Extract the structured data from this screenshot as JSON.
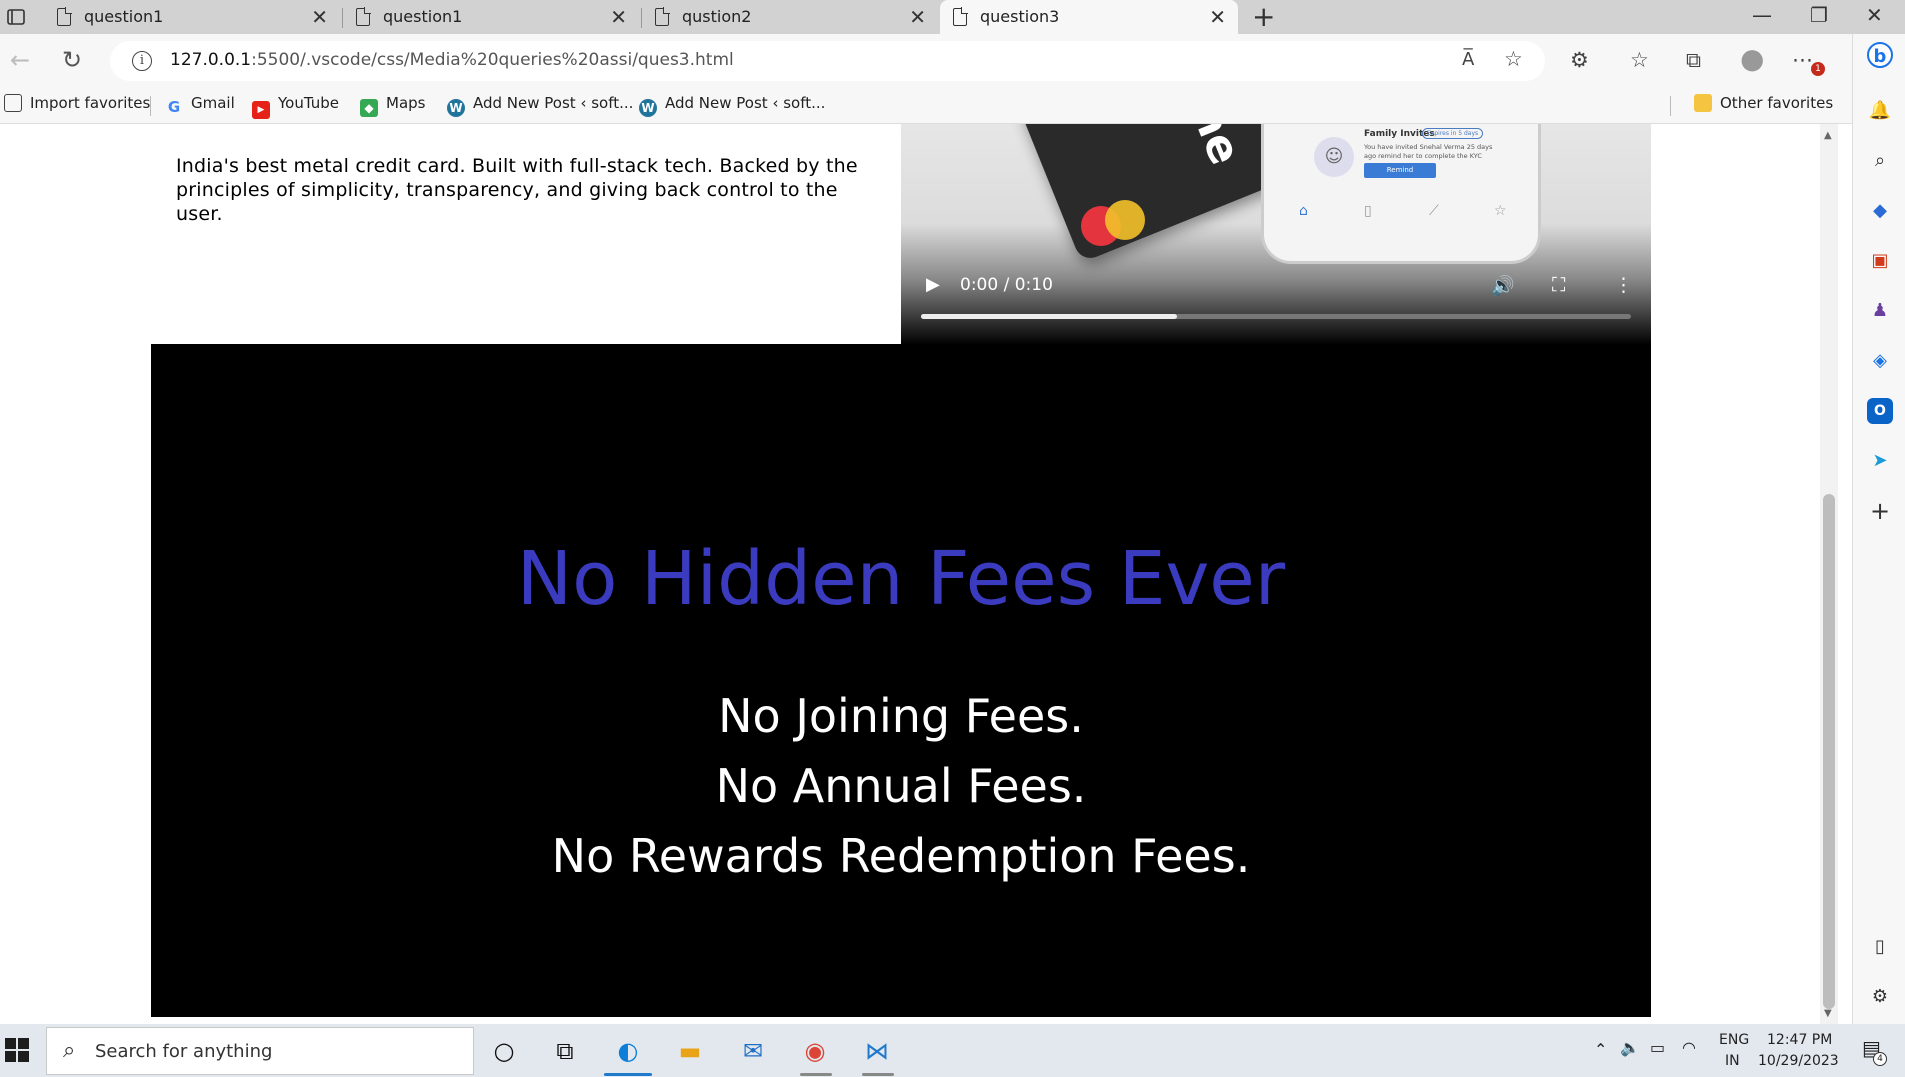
{
  "browser": {
    "tabs": [
      {
        "title": "question1",
        "active": false
      },
      {
        "title": "question1",
        "active": false
      },
      {
        "title": "qustion2",
        "active": false
      },
      {
        "title": "question3",
        "active": true
      }
    ],
    "url_host": "127.0.0.1",
    "url_rest": ":5500/.vscode/css/Media%20queries%20assi/ques3.html",
    "bookmarks": [
      "Import favorites",
      "Gmail",
      "YouTube",
      "Maps",
      "Add New Post ‹ soft...",
      "Add New Post ‹ soft..."
    ],
    "other_favorites": "Other favorites",
    "read_aloud": "A̅",
    "notification_badge": "1"
  },
  "page": {
    "intro_text": "India's best metal credit card. Built with full-stack tech. Backed by the principles of simplicity, transparency, and giving back control to the user.",
    "video": {
      "time": "0:00 / 0:10",
      "progress": 0.36,
      "card_text": "one",
      "app_title": "Family Invites",
      "app_badge": "Expires in 5 days",
      "app_body": "You have invited Snehal Verma 25 days ago remind her to complete the KYC",
      "app_button": "Remind"
    },
    "headline": "No Hidden Fees Ever",
    "fees": [
      "No Joining Fees.",
      "No Annual Fees.",
      "No Rewards Redemption Fees."
    ]
  },
  "taskbar": {
    "search_placeholder": "Search for anything",
    "lang": "ENG",
    "region": "IN",
    "time": "12:47 PM",
    "date": "10/29/2023",
    "notifications": "4"
  },
  "colors": {
    "headline": "#3b3bbf",
    "background_block": "#000000"
  }
}
